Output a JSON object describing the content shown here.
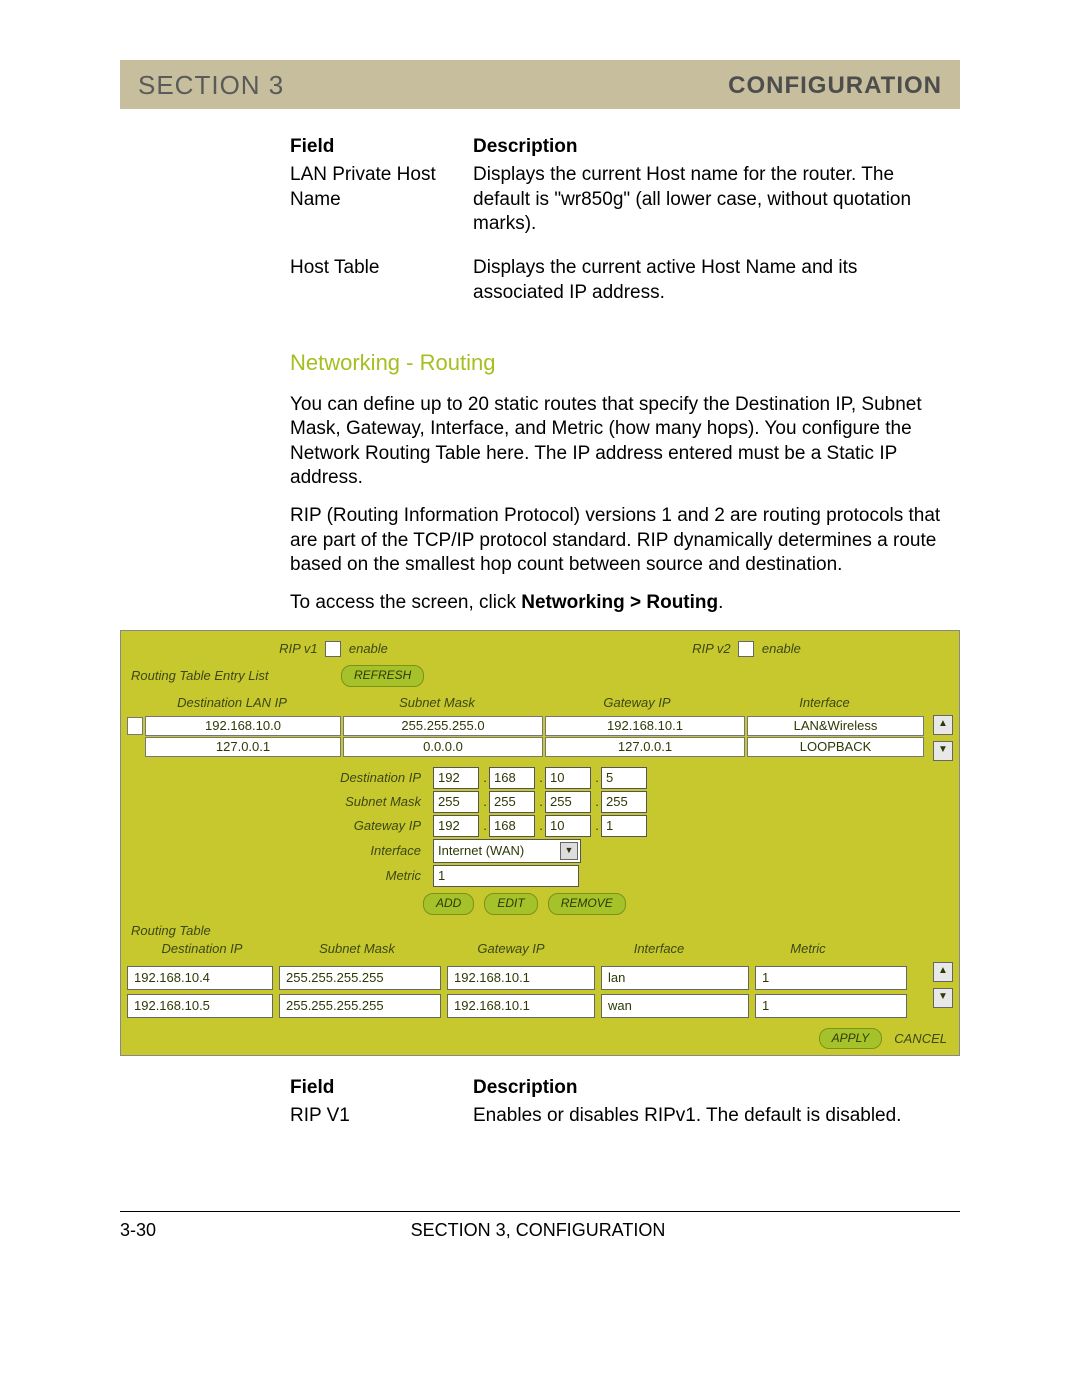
{
  "header": {
    "left": "SECTION 3",
    "right": "CONFIGURATION"
  },
  "table1": {
    "h1": "Field",
    "h2": "Description",
    "r": [
      {
        "f": "LAN Private Host Name",
        "d": "Displays the current Host name for the router. The default is \"wr850g\" (all lower case, without quotation marks)."
      },
      {
        "f": "Host Table",
        "d": "Displays the current active Host Name and its associated IP address."
      }
    ]
  },
  "section_title": "Networking - Routing",
  "p1": "You can define up to 20 static routes that specify the Destination IP, Subnet Mask, Gateway, Interface, and Metric (how many hops). You configure the Network Routing Table here.  The IP address entered must be a Static IP address.",
  "p2": "RIP (Routing Information Protocol) versions 1 and 2 are routing protocols that are part of the TCP/IP protocol standard. RIP dynamically determines a route based on the smallest hop count between source and destination.",
  "p3a": "To access the screen, click ",
  "p3b": "Networking > Routing",
  "p3c": ".",
  "ss": {
    "rip1_pre": "RIP v1 ",
    "rip1_post": " enable",
    "rip2_pre": "RIP v2 ",
    "rip2_post": " enable",
    "entry_list": "Routing Table Entry List",
    "refresh": "REFRESH",
    "eh": {
      "a": "Destination LAN IP",
      "b": "Subnet Mask",
      "c": "Gateway IP",
      "d": "Interface"
    },
    "entries": [
      {
        "a": "192.168.10.0",
        "b": "255.255.255.0",
        "c": "192.168.10.1",
        "d": "LAN&Wireless"
      },
      {
        "a": "127.0.0.1",
        "b": "0.0.0.0",
        "c": "127.0.0.1",
        "d": "LOOPBACK"
      }
    ],
    "form": {
      "dest": "Destination IP",
      "mask": "Subnet Mask",
      "gw": "Gateway IP",
      "if": "Interface",
      "metric": "Metric",
      "dest_v": [
        "192",
        "168",
        "10",
        "5"
      ],
      "mask_v": [
        "255",
        "255",
        "255",
        "255"
      ],
      "gw_v": [
        "192",
        "168",
        "10",
        "1"
      ],
      "if_v": "Internet (WAN)",
      "metric_v": "1",
      "add": "ADD",
      "edit": "EDIT",
      "remove": "REMOVE"
    },
    "rt_title": "Routing Table",
    "rth": {
      "a": "Destination IP",
      "b": "Subnet Mask",
      "c": "Gateway IP",
      "d": "Interface",
      "e": "Metric"
    },
    "rt_rows": [
      {
        "a": "192.168.10.4",
        "b": "255.255.255.255",
        "c": "192.168.10.1",
        "d": "lan",
        "e": "1"
      },
      {
        "a": "192.168.10.5",
        "b": "255.255.255.255",
        "c": "192.168.10.1",
        "d": "wan",
        "e": "1"
      }
    ],
    "apply": "APPLY",
    "cancel": "CANCEL"
  },
  "table2": {
    "h1": "Field",
    "h2": "Description",
    "r": [
      {
        "f": "RIP V1",
        "d": "Enables or disables RIPv1. The default is disabled."
      }
    ]
  },
  "footer": {
    "left": "3-30",
    "center": "SECTION 3, CONFIGURATION"
  }
}
